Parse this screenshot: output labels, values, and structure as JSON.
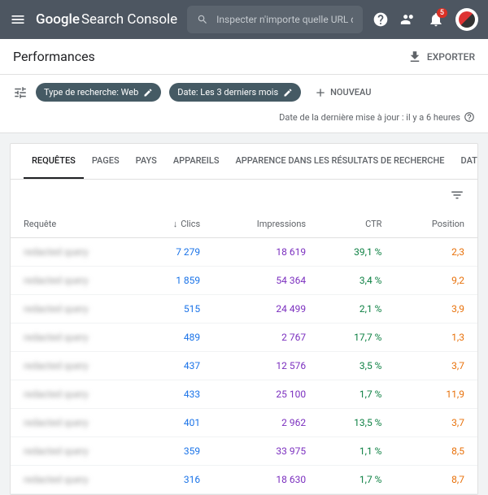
{
  "topbar": {
    "logo_google": "Google",
    "logo_product": "Search Console",
    "search_placeholder": "Inspecter n'importe quelle URL de \"http:",
    "notif_count": "5"
  },
  "page": {
    "title": "Performances",
    "export_label": "EXPORTER"
  },
  "filters": {
    "chip_type": "Type de recherche: Web",
    "chip_date": "Date: Les 3 derniers mois",
    "new_label": "NOUVEAU"
  },
  "update_text": "Date de la dernière mise à jour : il y a 6 heures",
  "tabs": [
    {
      "label": "REQUÊTES",
      "active": true
    },
    {
      "label": "PAGES",
      "active": false
    },
    {
      "label": "PAYS",
      "active": false
    },
    {
      "label": "APPAREILS",
      "active": false
    },
    {
      "label": "APPARENCE DANS LES RÉSULTATS DE RECHERCHE",
      "active": false
    },
    {
      "label": "DATES",
      "active": false
    }
  ],
  "table": {
    "headers": {
      "query": "Requête",
      "clicks": "Clics",
      "impressions": "Impressions",
      "ctr": "CTR",
      "position": "Position"
    },
    "rows": [
      {
        "query": "redacted query",
        "clicks": "7 279",
        "impressions": "18 619",
        "ctr": "39,1 %",
        "position": "2,3"
      },
      {
        "query": "redacted query",
        "clicks": "1 859",
        "impressions": "54 364",
        "ctr": "3,4 %",
        "position": "9,2"
      },
      {
        "query": "redacted query",
        "clicks": "515",
        "impressions": "24 499",
        "ctr": "2,1 %",
        "position": "3,9"
      },
      {
        "query": "redacted query",
        "clicks": "489",
        "impressions": "2 767",
        "ctr": "17,7 %",
        "position": "1,3"
      },
      {
        "query": "redacted query",
        "clicks": "437",
        "impressions": "12 576",
        "ctr": "3,5 %",
        "position": "3,7"
      },
      {
        "query": "redacted query",
        "clicks": "433",
        "impressions": "25 100",
        "ctr": "1,7 %",
        "position": "11,9"
      },
      {
        "query": "redacted query",
        "clicks": "401",
        "impressions": "2 962",
        "ctr": "13,5 %",
        "position": "3,7"
      },
      {
        "query": "redacted query",
        "clicks": "359",
        "impressions": "33 975",
        "ctr": "1,1 %",
        "position": "8,5"
      },
      {
        "query": "redacted query",
        "clicks": "316",
        "impressions": "18 630",
        "ctr": "1,7 %",
        "position": "8,7"
      }
    ]
  }
}
